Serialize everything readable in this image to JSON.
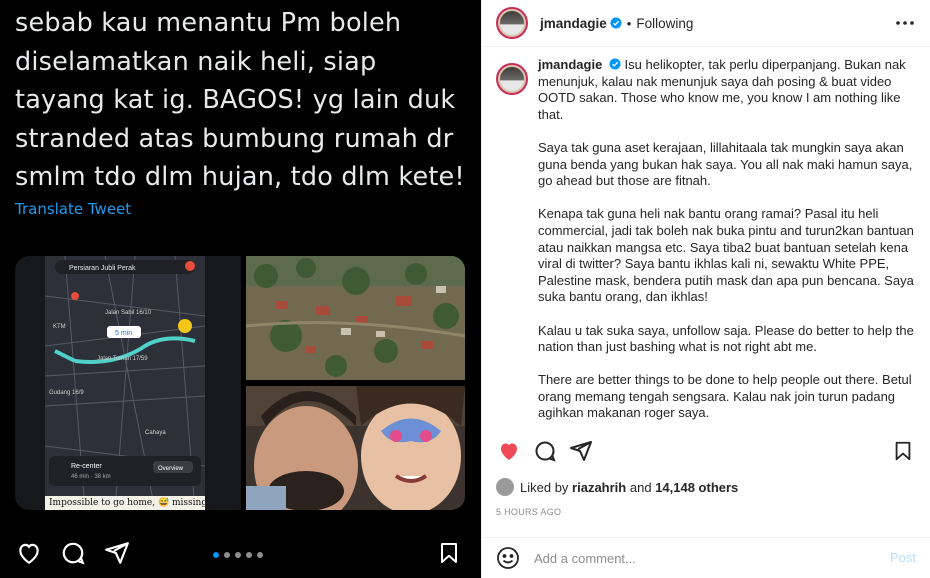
{
  "media": {
    "tweet_lines": [
      "sebab kau menantu Pm boleh",
      "diselamatkan naik heli, siap",
      "tayang kat ig. BAGOS! yg lain duk",
      "stranded atas bumbung rumah dr",
      "smlm tdo dlm hujan, tdo dlm kete!"
    ],
    "translate": "Translate Tweet",
    "map_labels": {
      "top": "Persiaran Jubli Perak",
      "road1": "Jalan Sabil 16/10",
      "eta": "5 min",
      "road2": "Jalan Toman 17/59",
      "ktm": "KTM",
      "area": "Cahaya",
      "road3": "Gudang 16/9",
      "recenter": "Re-center",
      "route": "46 min · 38 km",
      "overview": "Overview"
    },
    "photo_caption": "Impossible to go home, 😅 missing",
    "carousel_count": 5,
    "carousel_active": 0
  },
  "post": {
    "username": "jmandagie",
    "following_label": "Following",
    "caption_paragraphs": [
      "Isu helikopter, tak perlu diperpanjang. Bukan nak menunjuk, kalau nak menunjuk saya dah posing & buat video OOTD sakan. Those who know me, you know I am nothing like that.",
      "Saya tak guna aset kerajaan, lillahitaala tak mungkin saya akan guna benda yang bukan hak saya. You all nak maki hamun saya, go ahead but those are fitnah.",
      "Kenapa tak guna heli nak bantu orang ramai? Pasal itu heli commercial, jadi tak boleh nak buka pintu and turun2kan bantuan atau naikkan mangsa etc. Saya tiba2 buat bantuan setelah kena viral di twitter? Saya bantu ikhlas kali ni, sewaktu White PPE, Palestine mask, bendera putih mask dan apa pun bencana. Saya suka bantu orang, dan ikhlas!",
      "Kalau u tak suka saya, unfollow saja. Please do better to help the nation than just bashing what is not right abt me.",
      "There are better things to be done to help people out there. Betul orang memang tengah sengsara. Kalau nak join turun padang agihkan makanan roger saya."
    ],
    "liked_by_prefix": "Liked by",
    "liked_by_user": "riazahrih",
    "liked_by_and": "and",
    "likes_count": "14,148 others",
    "timestamp": "5 HOURS AGO",
    "comment_placeholder": "Add a comment...",
    "post_label": "Post",
    "colors": {
      "like_red": "#ed4956",
      "link_blue": "#0095f6",
      "post_disabled": "#b2dffc",
      "verified": "#0095f6"
    }
  }
}
